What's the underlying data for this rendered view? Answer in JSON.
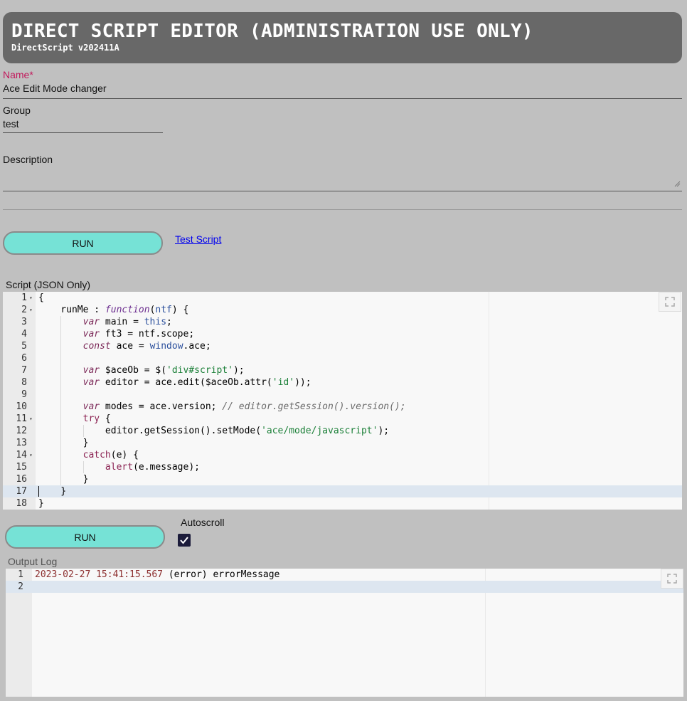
{
  "header": {
    "title": "DIRECT SCRIPT EDITOR (ADMINISTRATION USE ONLY)",
    "subtitle": "DirectScript v202411A"
  },
  "form": {
    "name_label": "Name",
    "name_required": "*",
    "name_value": "Ace Edit Mode changer",
    "group_label": "Group",
    "group_value": "test",
    "description_label": "Description",
    "description_value": ""
  },
  "actions": {
    "run_label": "RUN",
    "test_script_label": " Test Script"
  },
  "script_editor": {
    "label": "Script (JSON Only)",
    "active_line": 17,
    "lines": [
      {
        "n": "1",
        "fold": true
      },
      {
        "n": "2",
        "fold": true
      },
      {
        "n": "3"
      },
      {
        "n": "4"
      },
      {
        "n": "5"
      },
      {
        "n": "6"
      },
      {
        "n": "7"
      },
      {
        "n": "8"
      },
      {
        "n": "9"
      },
      {
        "n": "10"
      },
      {
        "n": "11",
        "fold": true
      },
      {
        "n": "12"
      },
      {
        "n": "13"
      },
      {
        "n": "14",
        "fold": true
      },
      {
        "n": "15"
      },
      {
        "n": "16"
      },
      {
        "n": "17"
      },
      {
        "n": "18"
      }
    ],
    "tokens": {
      "l1": [
        "{"
      ],
      "l2": [
        "    runMe : ",
        "function",
        "(",
        "ntf",
        ") {"
      ],
      "l3": [
        "        ",
        "var",
        " main = ",
        "this",
        ";"
      ],
      "l4": [
        "        ",
        "var",
        " ft3 = ntf.scope;"
      ],
      "l5": [
        "        ",
        "const",
        " ace = ",
        "window",
        ".ace;"
      ],
      "l7": [
        "        ",
        "var",
        " $aceOb = $(",
        "'div#script'",
        ");"
      ],
      "l8": [
        "        ",
        "var",
        " editor = ace.edit($aceOb.attr(",
        "'id'",
        "));"
      ],
      "l10": [
        "        ",
        "var",
        " modes = ace.version; ",
        "// editor.getSession().version();"
      ],
      "l11": [
        "        ",
        "try",
        " {"
      ],
      "l12": [
        "            editor.getSession().setMode(",
        "'ace/mode/javascript'",
        ");"
      ],
      "l13": [
        "        }"
      ],
      "l14": [
        "        ",
        "catch",
        "(e) {"
      ],
      "l15": [
        "            ",
        "alert",
        "(e.message);"
      ],
      "l16": [
        "        }"
      ],
      "l17": [
        "    }"
      ],
      "l18": [
        "}"
      ]
    }
  },
  "output": {
    "autoscroll_label": "Autoscroll",
    "autoscroll_checked": true,
    "log_label": "Output Log",
    "lines": [
      {
        "n": "1",
        "timestamp": "2023-02-27 15:41:15.567",
        "text": " (error) errorMessage"
      },
      {
        "n": "2",
        "timestamp": "",
        "text": ""
      }
    ],
    "active_line": 2
  },
  "colors": {
    "background": "#c0c0c0",
    "header": "#686868",
    "run_button": "#76e2d6",
    "required": "#c2185b",
    "link": "#0000ee"
  }
}
